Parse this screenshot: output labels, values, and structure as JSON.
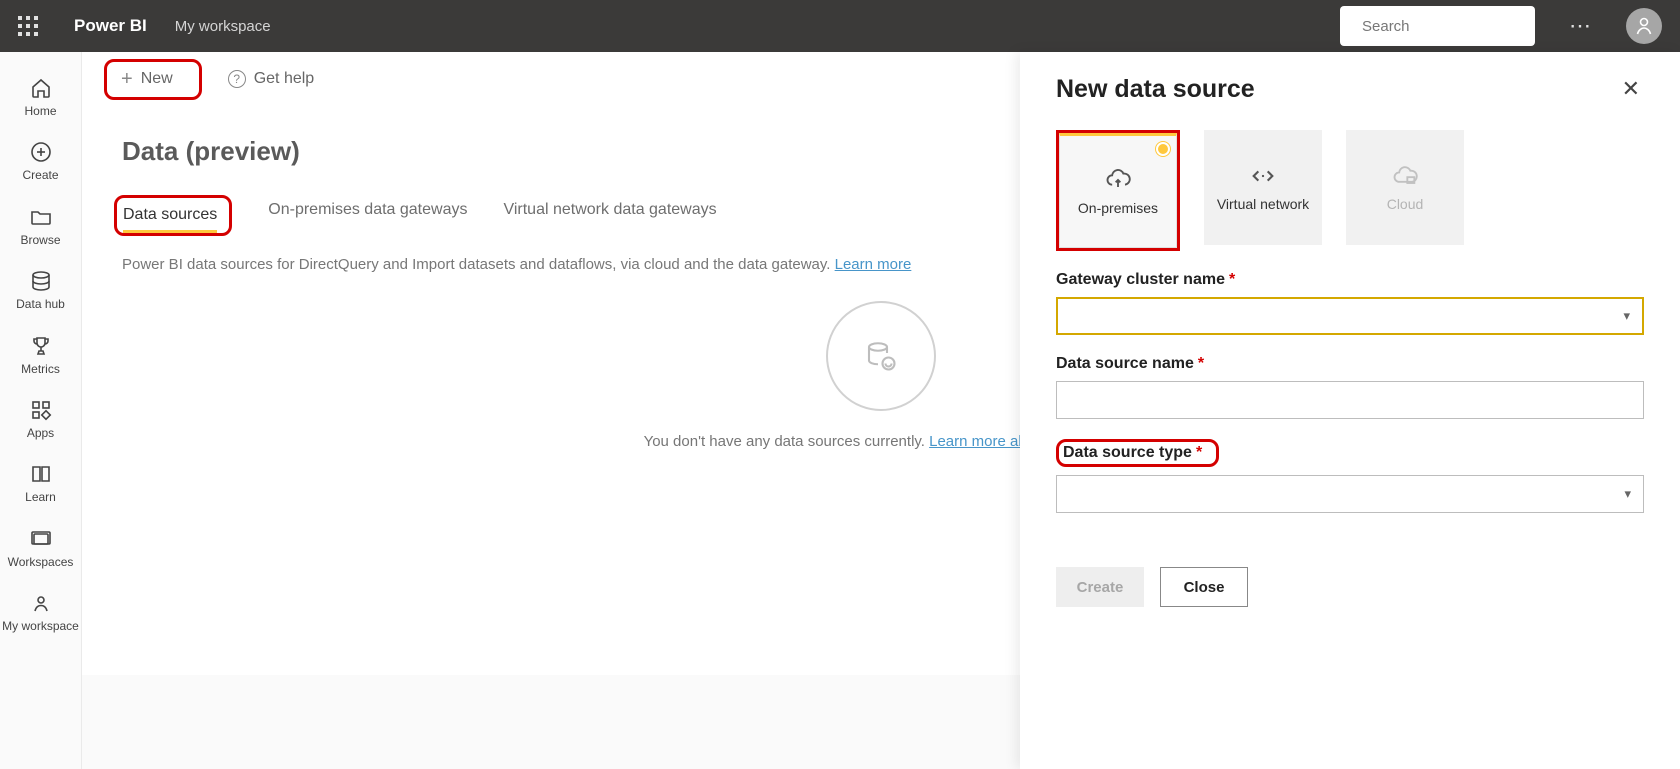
{
  "header": {
    "product": "Power BI",
    "workspace": "My workspace",
    "search_placeholder": "Search"
  },
  "sidebar": {
    "items": [
      {
        "label": "Home"
      },
      {
        "label": "Create"
      },
      {
        "label": "Browse"
      },
      {
        "label": "Data hub"
      },
      {
        "label": "Metrics"
      },
      {
        "label": "Apps"
      },
      {
        "label": "Learn"
      },
      {
        "label": "Workspaces"
      },
      {
        "label": "My workspace"
      }
    ]
  },
  "toolbar": {
    "new_label": "New",
    "help_label": "Get help"
  },
  "page": {
    "heading": "Data (preview)",
    "tabs": [
      {
        "label": "Data sources"
      },
      {
        "label": "On-premises data gateways"
      },
      {
        "label": "Virtual network data gateways"
      }
    ],
    "description": "Power BI data sources for DirectQuery and Import datasets and dataflows, via cloud and the data gateway. ",
    "description_link": "Learn more",
    "empty_text": "You don't have any data sources currently. ",
    "empty_link": "Learn more about supported"
  },
  "panel": {
    "title": "New data source",
    "types": [
      {
        "label": "On-premises"
      },
      {
        "label": "Virtual network"
      },
      {
        "label": "Cloud"
      }
    ],
    "fields": {
      "gateway_cluster_label": "Gateway cluster name",
      "data_source_name_label": "Data source name",
      "data_source_type_label": "Data source type"
    },
    "actions": {
      "create": "Create",
      "close": "Close"
    }
  }
}
